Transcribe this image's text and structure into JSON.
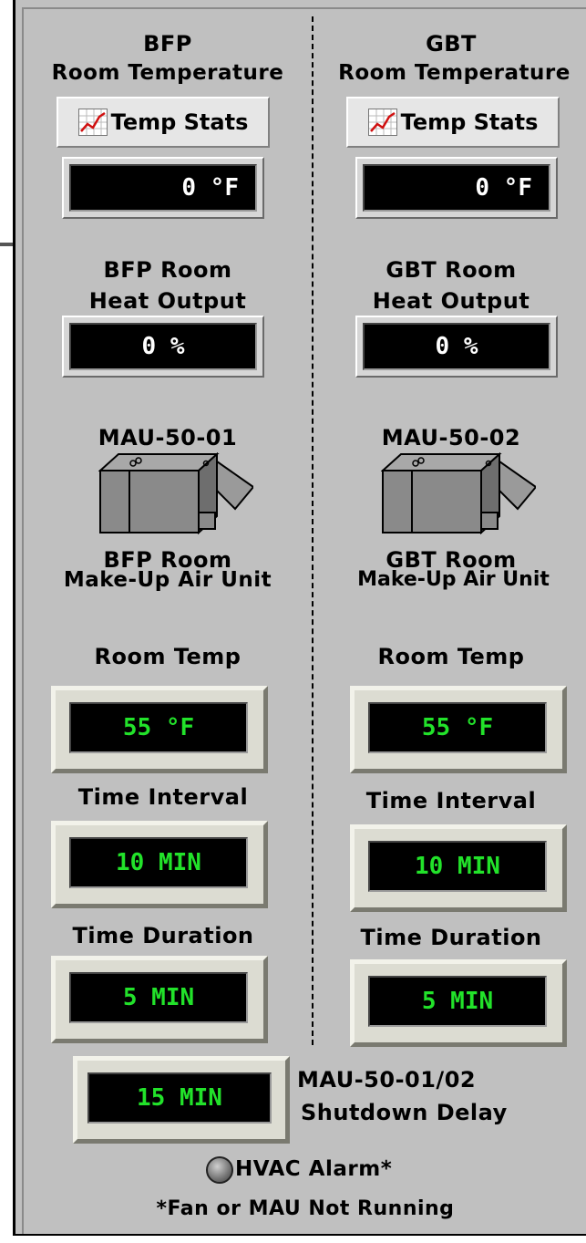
{
  "left": {
    "title_line1": "BFP",
    "title_line2": "Room Temperature",
    "temp_stats_button": "Temp Stats",
    "room_temp_display": "0 °F",
    "heat_label_line1": "BFP Room",
    "heat_label_line2": "Heat Output",
    "heat_output_display": "0 %",
    "mau_id": "MAU-50-01",
    "mau_label_line1": "BFP Room",
    "mau_label_line2": "Make-Up Air Unit",
    "room_temp_label": "Room Temp",
    "room_temp_setpoint": "55 °F",
    "time_interval_label": "Time Interval",
    "time_interval_value": "10 MIN",
    "time_duration_label": "Time Duration",
    "time_duration_value": "5 MIN"
  },
  "right": {
    "title_line1": "GBT",
    "title_line2": "Room Temperature",
    "temp_stats_button": "Temp Stats",
    "room_temp_display": "0 °F",
    "heat_label_line1": "GBT Room",
    "heat_label_line2": "Heat Output",
    "heat_output_display": "0 %",
    "mau_id": "MAU-50-02",
    "mau_label_line1": "GBT Room",
    "mau_label_line2": "Make-Up Air Unit",
    "room_temp_label": "Room Temp",
    "room_temp_setpoint": "55 °F",
    "time_interval_label": "Time Interval",
    "time_interval_value": "10 MIN",
    "time_duration_label": "Time Duration",
    "time_duration_value": "5 MIN"
  },
  "shutdown": {
    "delay_value": "15 MIN",
    "label_line1": "MAU-50-01/02",
    "label_line2": "Shutdown Delay"
  },
  "alarm": {
    "label": "HVAC Alarm*",
    "footnote": "*Fan or MAU Not Running"
  },
  "icons": {
    "chart": "chart-icon",
    "mau": "air-unit-icon",
    "lamp": "indicator-lamp-icon"
  },
  "colors": {
    "panel": "#c0c0c0",
    "display_bg": "#000000",
    "setpoint_text": "#22e22a",
    "readout_text": "#ffffff"
  }
}
